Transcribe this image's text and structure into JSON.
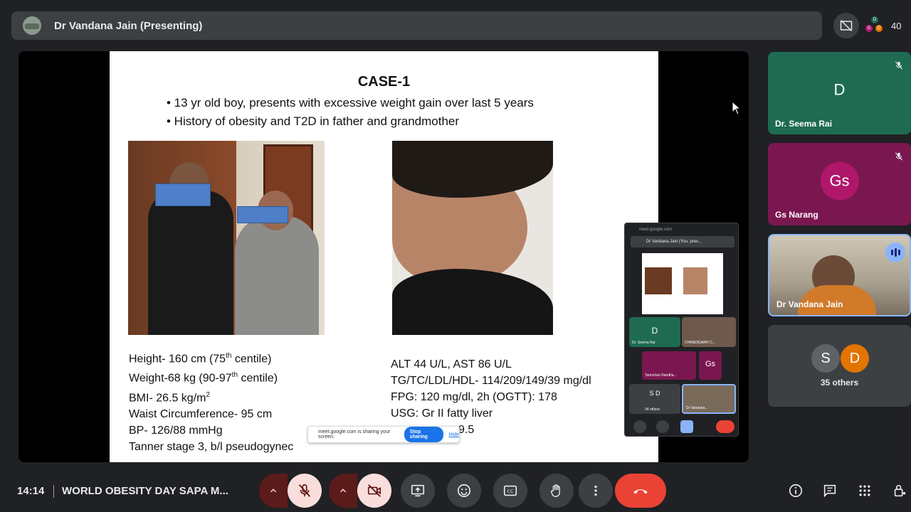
{
  "header": {
    "presenter_title": "Dr Vandana Jain (Presenting)",
    "participant_count": "40",
    "mini_avatars": [
      "D",
      "G",
      "D"
    ]
  },
  "slide": {
    "title": "CASE-1",
    "bullets": [
      "• 13 yr old boy,  presents with excessive weight gain over last 5 years",
      "• History of obesity and T2D in father and grandmother"
    ],
    "left_stats": {
      "height_a": "Height- 160 cm (75",
      "height_sup": "th",
      "height_b": " centile)",
      "weight_a": "Weight-68 kg (90-97",
      "weight_sup": "th",
      "weight_b": " centile)",
      "bmi_a": "BMI- 26.5 kg/m",
      "bmi_sup": "2",
      "waist": "Waist Circumference- 95 cm",
      "bp": "BP- 126/88 mmHg",
      "tanner": "Tanner stage 3, b/l pseudogynec"
    },
    "right_stats": [
      "ALT 44 U/L, AST 86 U/L",
      "TG/TC/LDL/HDL- 114/209/149/39 mg/dl",
      "FPG: 120 mg/dl, 2h (OGTT): 178",
      "USG: Gr II fatty liver",
      "9.5"
    ]
  },
  "share_bar": {
    "message": "meet.google.com is sharing your screen.",
    "stop_label": "Stop sharing",
    "hide_label": "Hide"
  },
  "pip": {
    "url": "meet.google.com",
    "header": "Dr Vandana Jain (You, pres...",
    "tiles": [
      {
        "initial": "D",
        "name": "Dr. Seema Rai"
      },
      {
        "initial": "",
        "name": "CHANDIGARH C..."
      },
      {
        "initial": "",
        "name": "Tarlochan Randha..."
      },
      {
        "initial": "Gs",
        "name": ""
      },
      {
        "initial": "S D",
        "name": "34 others"
      },
      {
        "initial": "",
        "name": "Dr Vandana..."
      }
    ]
  },
  "side_tiles": [
    {
      "initial": "D",
      "name": "Dr. Seema Rai",
      "color": "#1e6b52",
      "avatar_color": "#1e6b52"
    },
    {
      "initial": "Gs",
      "name": "Gs Narang",
      "color": "#7b1750",
      "avatar_color": "#b0176b"
    },
    {
      "initial": "",
      "name": "Dr Vandana Jain",
      "color": "#6d6a63",
      "avatar_color": ""
    }
  ],
  "others": {
    "avatars": [
      "S",
      "D"
    ],
    "label": "35 others"
  },
  "footer": {
    "time": "14:14",
    "meeting_name": "WORLD OBESITY DAY SAPA M..."
  },
  "colors": {
    "accent": "#8ab4f8",
    "end_call": "#ea4335",
    "muted_bg": "#f9dedc"
  }
}
